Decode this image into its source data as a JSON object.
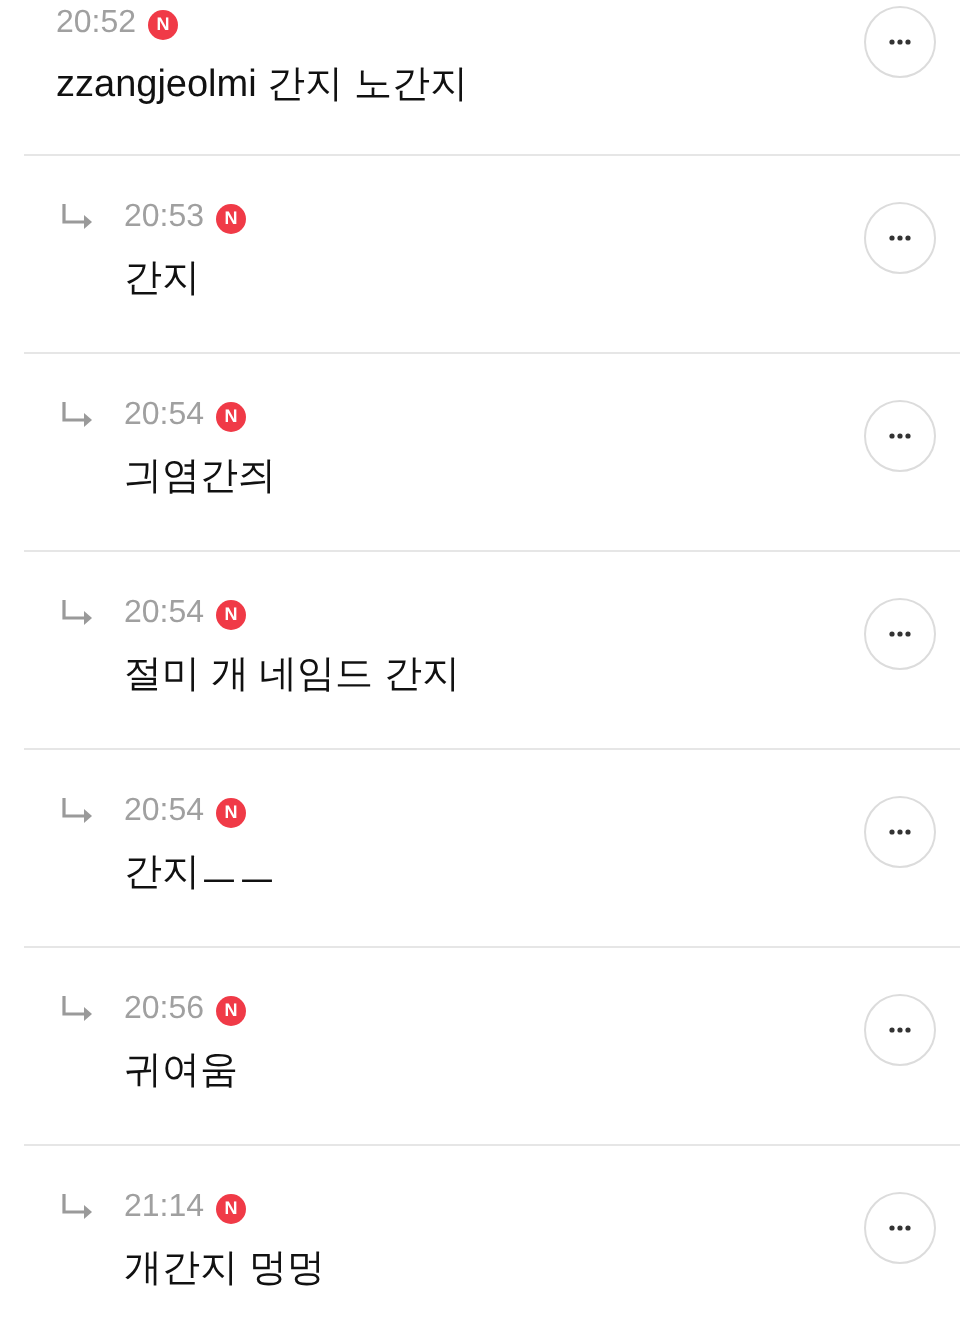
{
  "comments": [
    {
      "kind": "comment",
      "time": "20:52",
      "badge": "N",
      "text": "zzangjeolmi 간지 노간지"
    },
    {
      "kind": "reply",
      "time": "20:53",
      "badge": "N",
      "text": "간지"
    },
    {
      "kind": "reply",
      "time": "20:54",
      "badge": "N",
      "text": "긔염간즤"
    },
    {
      "kind": "reply",
      "time": "20:54",
      "badge": "N",
      "text": "절미 개 네임드 간지"
    },
    {
      "kind": "reply",
      "time": "20:54",
      "badge": "N",
      "text": "간지ㅡㅡ"
    },
    {
      "kind": "reply",
      "time": "20:56",
      "badge": "N",
      "text": "귀여움"
    },
    {
      "kind": "reply",
      "time": "21:14",
      "badge": "N",
      "text": "개간지 멍멍"
    }
  ]
}
